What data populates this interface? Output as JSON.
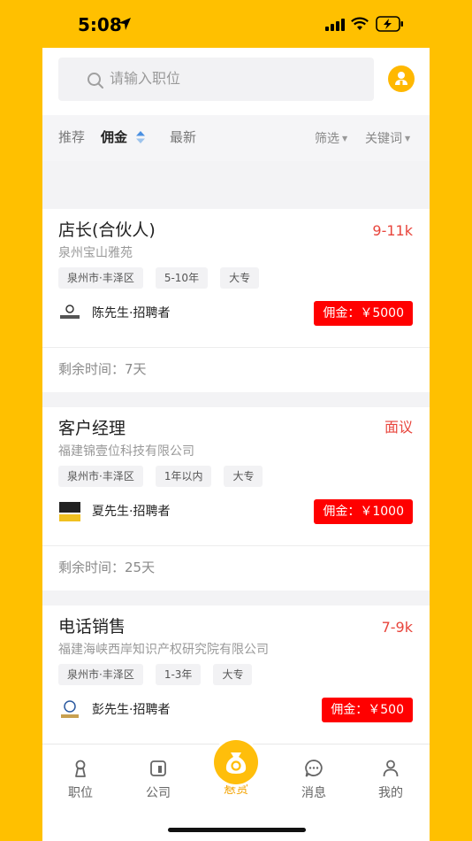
{
  "status_bar": {
    "time": "5:08"
  },
  "search": {
    "placeholder": "请输入职位"
  },
  "filter": {
    "tabs": [
      "推荐",
      "佣金",
      "最新"
    ],
    "active_tab": "佣金",
    "dropdowns": [
      "筛选",
      "关键词"
    ]
  },
  "jobs": [
    {
      "title": "店长(合伙人)",
      "salary": "9-11k",
      "company": "泉州宝山雅苑",
      "tags": [
        "泉州市·丰泽区",
        "5-10年",
        "大专"
      ],
      "recruiter": "陈先生·招聘者",
      "commission": "佣金：￥5000",
      "remaining": "剩余时间：7天"
    },
    {
      "title": "客户经理",
      "salary": "面议",
      "company": "福建锦壹位科技有限公司",
      "tags": [
        "泉州市·丰泽区",
        "1年以内",
        "大专"
      ],
      "recruiter": "夏先生·招聘者",
      "commission": "佣金：￥1000",
      "remaining": "剩余时间：25天"
    },
    {
      "title": "电话销售",
      "salary": "7-9k",
      "company": "福建海峡西岸知识产权研究院有限公司",
      "tags": [
        "泉州市·丰泽区",
        "1-3年",
        "大专"
      ],
      "recruiter": "彭先生·招聘者",
      "commission": "佣金：￥500",
      "remaining": ""
    }
  ],
  "tab_bar": {
    "items": [
      "职位",
      "公司",
      "悬赏",
      "消息",
      "我的"
    ],
    "active": "悬赏"
  },
  "colors": {
    "brand_yellow": "#FFC000",
    "salary_red": "#E8453C",
    "commission_red": "#FF0000",
    "reward_active": "#F4A300"
  }
}
